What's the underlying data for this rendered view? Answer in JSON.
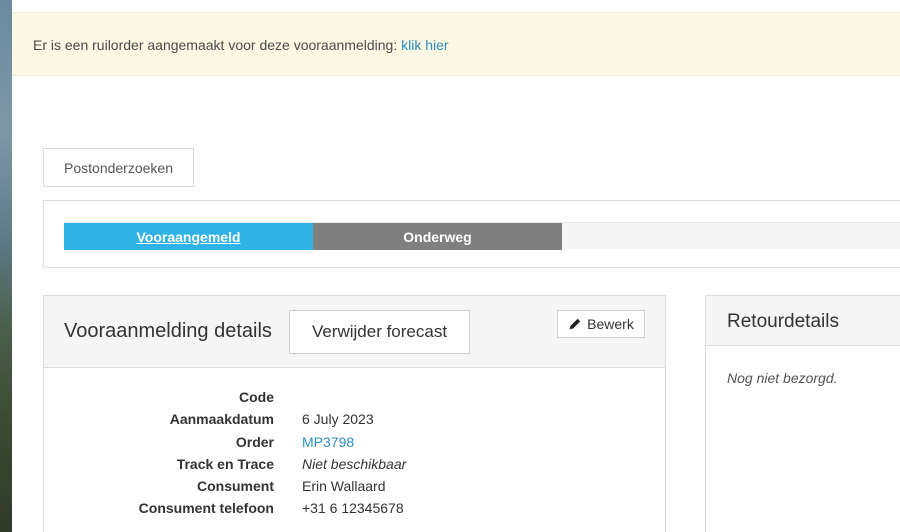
{
  "alert": {
    "text": "Er is een ruilorder aangemaakt voor deze vooraanmelding:",
    "link": "klik hier"
  },
  "tab_button": "Postonderzoeken",
  "progress": {
    "steps": [
      {
        "label": "Vooraangemeld",
        "state": "active"
      },
      {
        "label": "Onderweg",
        "state": "pending"
      }
    ]
  },
  "details_panel": {
    "title": "Vooraanmelding details",
    "forecast_button": "Verwijder forecast",
    "edit_button": "Bewerk",
    "fields": [
      {
        "label": "Code",
        "value": ""
      },
      {
        "label": "Aanmaakdatum",
        "value": "6 July 2023"
      },
      {
        "label": "Order",
        "value": "MP3798"
      },
      {
        "label": "Track en Trace",
        "value": "Niet beschikbaar"
      },
      {
        "label": "Consument",
        "value": "Erin Wallaard"
      },
      {
        "label": "Consument telefoon",
        "value": "+31 6 12345678"
      }
    ]
  },
  "return_panel": {
    "title": "Retourdetails",
    "note": "Nog niet bezorgd."
  },
  "colors": {
    "alert_bg": "#fcf8e3",
    "link": "#2a8fc1",
    "step_active": "#2fb3e6",
    "step_pending": "#7f7f7f"
  },
  "icons": {
    "edit": "pencil-icon"
  }
}
